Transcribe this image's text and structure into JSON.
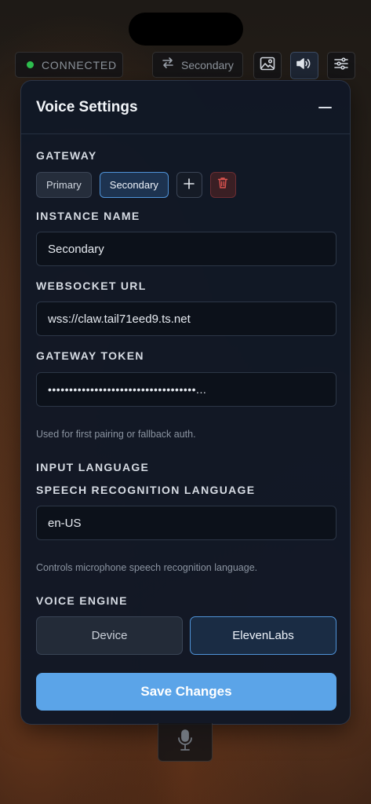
{
  "status": {
    "label": "CONNECTED",
    "dot_color": "#2fbf4f"
  },
  "topbar": {
    "instance_label": "Secondary",
    "icons": [
      "switch-icon",
      "image-icon",
      "speaker-icon",
      "sliders-icon"
    ]
  },
  "panel": {
    "title": "Voice Settings",
    "gateway": {
      "label": "GATEWAY",
      "options": [
        {
          "label": "Primary",
          "active": false
        },
        {
          "label": "Secondary",
          "active": true
        }
      ]
    },
    "instance_name": {
      "label": "INSTANCE NAME",
      "value": "Secondary"
    },
    "websocket_url": {
      "label": "WEBSOCKET URL",
      "value": "wss://claw.tail71eed9.ts.net"
    },
    "gateway_token": {
      "label": "GATEWAY TOKEN",
      "value": "•••••••••••••••••••••••••••••••••••...",
      "hint": "Used for first pairing or fallback auth."
    },
    "input_language": {
      "label": "INPUT LANGUAGE",
      "speech_label": "SPEECH RECOGNITION LANGUAGE",
      "value": "en-US",
      "hint": "Controls microphone speech recognition language."
    },
    "voice_engine": {
      "label": "VOICE ENGINE",
      "options": [
        {
          "label": "Device",
          "active": false
        },
        {
          "label": "ElevenLabs",
          "active": true
        }
      ]
    },
    "save_label": "Save Changes"
  },
  "colors": {
    "accent": "#5ba4e8",
    "panel_bg": "#111826",
    "danger": "#d9534f"
  }
}
